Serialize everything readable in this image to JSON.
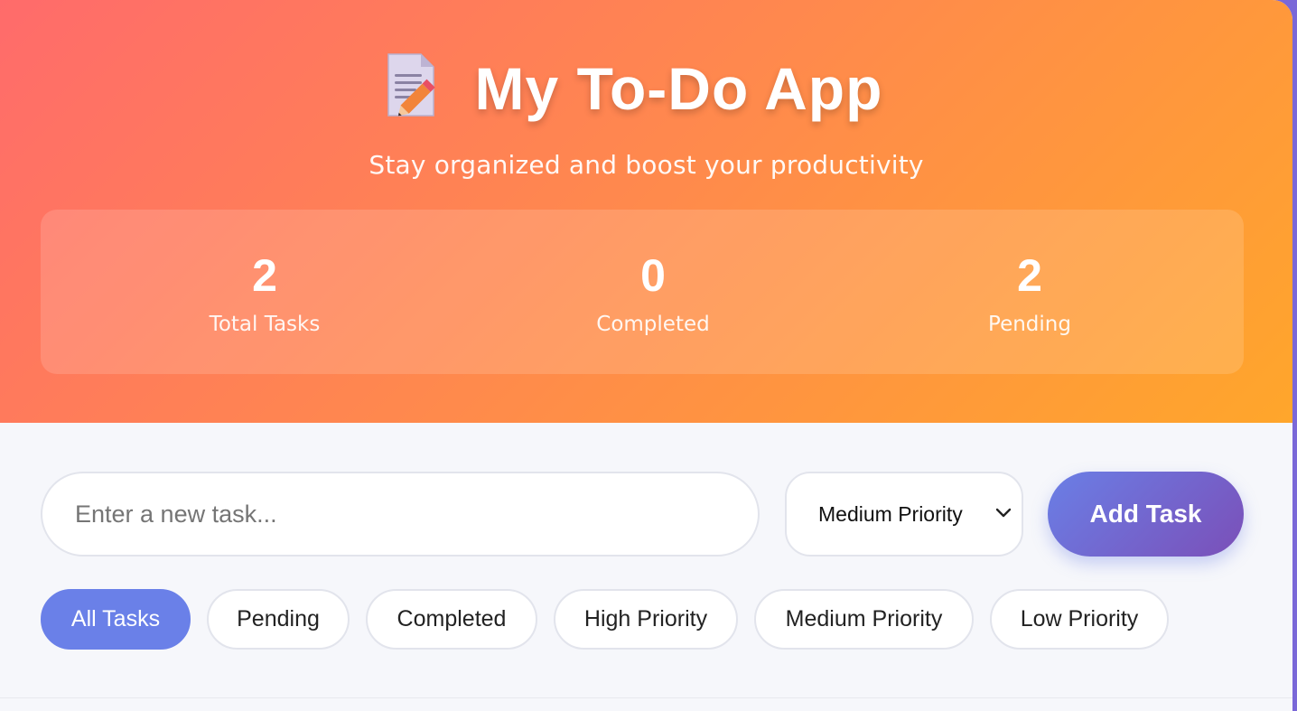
{
  "header": {
    "title": "My To-Do App",
    "icon": "memo-icon",
    "subtitle": "Stay organized and boost your productivity"
  },
  "stats": [
    {
      "value": "2",
      "label": "Total Tasks"
    },
    {
      "value": "0",
      "label": "Completed"
    },
    {
      "value": "2",
      "label": "Pending"
    }
  ],
  "task_input": {
    "placeholder": "Enter a new task...",
    "value": ""
  },
  "priority_select": {
    "selected": "Medium Priority",
    "icon": "chevron-down-icon"
  },
  "add_button": {
    "label": "Add Task"
  },
  "filters": [
    {
      "label": "All Tasks",
      "active": true
    },
    {
      "label": "Pending",
      "active": false
    },
    {
      "label": "Completed",
      "active": false
    },
    {
      "label": "High Priority",
      "active": false
    },
    {
      "label": "Medium Priority",
      "active": false
    },
    {
      "label": "Low Priority",
      "active": false
    }
  ],
  "colors": {
    "header_gradient": [
      "#ff6b6b",
      "#ff8a4c",
      "#ffa62b"
    ],
    "accent": "#6a80e8",
    "button_gradient": [
      "#6a7fe6",
      "#7b4fb8"
    ],
    "background": "#f6f7fb"
  }
}
